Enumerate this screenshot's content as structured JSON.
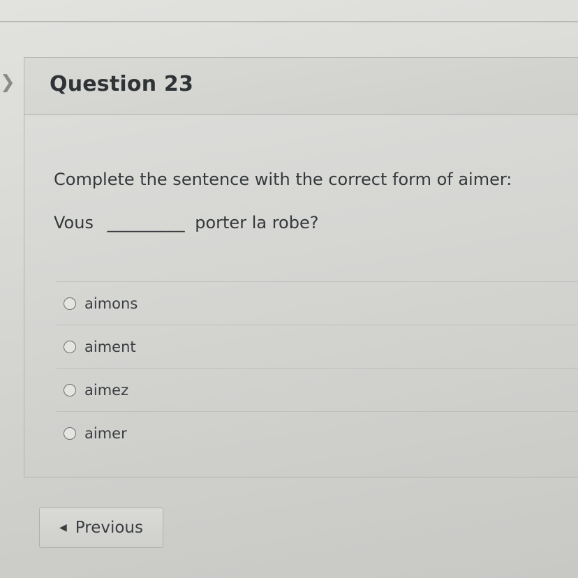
{
  "question": {
    "title": "Question 23",
    "prompt": "Complete the sentence with the correct form of aimer:",
    "sentence_start": "Vous",
    "blank": "__________",
    "sentence_end": "porter la robe?"
  },
  "answers": [
    {
      "label": "aimons",
      "selected": false
    },
    {
      "label": "aiment",
      "selected": false
    },
    {
      "label": "aimez",
      "selected": false
    },
    {
      "label": "aimer",
      "selected": false
    }
  ],
  "navigation": {
    "previous_label": "Previous",
    "previous_icon": "left-triangle-icon",
    "side_icon": "chevron-right-icon"
  }
}
